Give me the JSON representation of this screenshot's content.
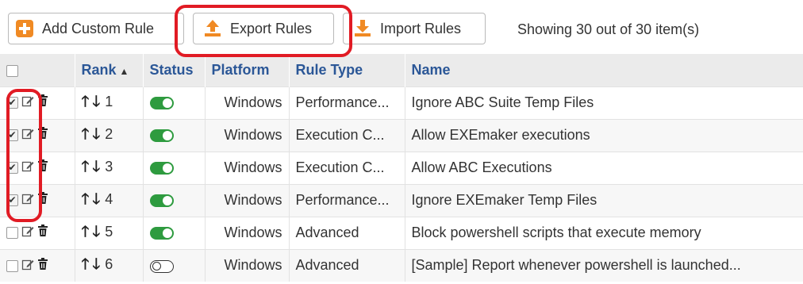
{
  "toolbar": {
    "add_label": "Add Custom Rule",
    "export_label": "Export Rules",
    "import_label": "Import Rules",
    "showing_text": "Showing 30 out of 30 item(s)",
    "accent_color": "#f08a24"
  },
  "columns": {
    "rank": "Rank",
    "status": "Status",
    "platform": "Platform",
    "rule_type": "Rule Type",
    "name": "Name"
  },
  "rows": [
    {
      "checked": true,
      "rank": "1",
      "status": "on",
      "platform": "Windows",
      "rule_type": "Performance...",
      "name": "Ignore ABC Suite Temp Files"
    },
    {
      "checked": true,
      "rank": "2",
      "status": "on",
      "platform": "Windows",
      "rule_type": "Execution C...",
      "name": "Allow EXEmaker executions"
    },
    {
      "checked": true,
      "rank": "3",
      "status": "on",
      "platform": "Windows",
      "rule_type": "Execution C...",
      "name": "Allow ABC Executions"
    },
    {
      "checked": true,
      "rank": "4",
      "status": "on",
      "platform": "Windows",
      "rule_type": "Performance...",
      "name": "Ignore EXEmaker Temp Files"
    },
    {
      "checked": false,
      "rank": "5",
      "status": "on",
      "platform": "Windows",
      "rule_type": "Advanced",
      "name": "Block powershell scripts that execute memory"
    },
    {
      "checked": false,
      "rank": "6",
      "status": "off",
      "platform": "Windows",
      "rule_type": "Advanced",
      "name": "[Sample] Report whenever powershell is launched..."
    }
  ],
  "icons": {
    "add": "plus-icon",
    "export": "export-icon",
    "import": "import-icon",
    "edit": "edit-icon",
    "delete": "trash-icon",
    "up": "arrow-up-icon",
    "down": "arrow-down-icon"
  },
  "highlight_color": "#e11b24",
  "toggle_on_color": "#2e9b3f"
}
